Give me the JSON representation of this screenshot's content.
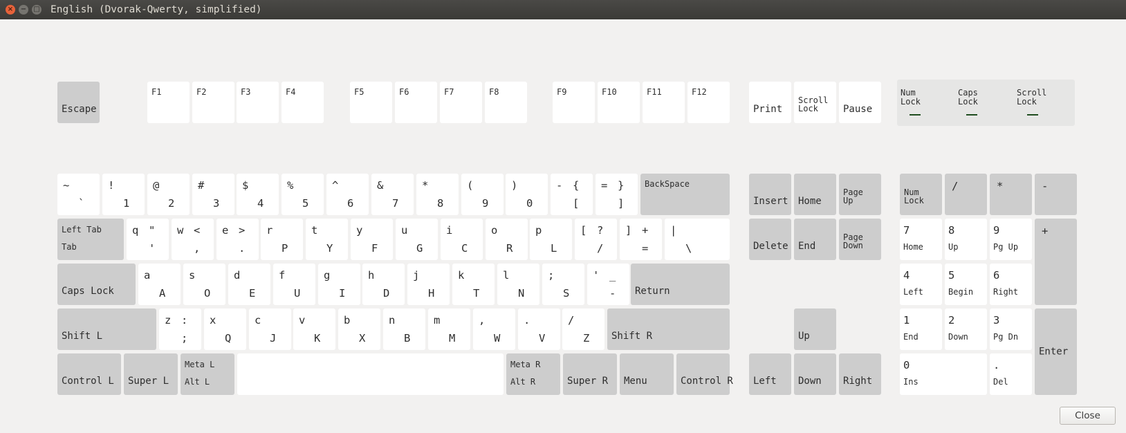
{
  "window": {
    "title": "English (Dvorak-Qwerty, simplified)",
    "close_glyph": "×",
    "minimize_glyph": "−",
    "maximize_glyph": "□"
  },
  "colors": {
    "titlebar": "#3c3b37",
    "background": "#f2f1f0",
    "key_light": "#ffffff",
    "key_dark": "#cdcdcd",
    "indicator_panel": "#e6e6e5",
    "led": "#1f4d1f"
  },
  "keys": [
    {
      "name": "escape",
      "labels": [
        "Escape"
      ]
    },
    {
      "name": "f1",
      "labels": [
        "F1"
      ]
    },
    {
      "name": "f2",
      "labels": [
        "F2"
      ]
    },
    {
      "name": "f3",
      "labels": [
        "F3"
      ]
    },
    {
      "name": "f4",
      "labels": [
        "F4"
      ]
    },
    {
      "name": "f5",
      "labels": [
        "F5"
      ]
    },
    {
      "name": "f6",
      "labels": [
        "F6"
      ]
    },
    {
      "name": "f7",
      "labels": [
        "F7"
      ]
    },
    {
      "name": "f8",
      "labels": [
        "F8"
      ]
    },
    {
      "name": "f9",
      "labels": [
        "F9"
      ]
    },
    {
      "name": "f10",
      "labels": [
        "F10"
      ]
    },
    {
      "name": "f11",
      "labels": [
        "F11"
      ]
    },
    {
      "name": "f12",
      "labels": [
        "F12"
      ]
    },
    {
      "name": "print",
      "labels": [
        "Print"
      ]
    },
    {
      "name": "scroll-lock",
      "labels": [
        "Scroll\nLock"
      ]
    },
    {
      "name": "pause",
      "labels": [
        "Pause"
      ]
    },
    {
      "name": "grave",
      "labels": [
        "~",
        "`"
      ]
    },
    {
      "name": "1",
      "labels": [
        "!",
        "1"
      ]
    },
    {
      "name": "2",
      "labels": [
        "@",
        "2"
      ]
    },
    {
      "name": "3",
      "labels": [
        "#",
        "3"
      ]
    },
    {
      "name": "4",
      "labels": [
        "$",
        "4"
      ]
    },
    {
      "name": "5",
      "labels": [
        "%",
        "5"
      ]
    },
    {
      "name": "6",
      "labels": [
        "^",
        "6"
      ]
    },
    {
      "name": "7",
      "labels": [
        "&",
        "7"
      ]
    },
    {
      "name": "8",
      "labels": [
        "*",
        "8"
      ]
    },
    {
      "name": "9",
      "labels": [
        "(",
        "9"
      ]
    },
    {
      "name": "0",
      "labels": [
        ")",
        "0"
      ]
    },
    {
      "name": "minus",
      "labels": [
        "-",
        "{",
        "["
      ]
    },
    {
      "name": "equal",
      "labels": [
        "=",
        "}",
        "]"
      ]
    },
    {
      "name": "backspace",
      "labels": [
        "BackSpace"
      ]
    },
    {
      "name": "insert",
      "labels": [
        "Insert"
      ]
    },
    {
      "name": "home",
      "labels": [
        "Home"
      ]
    },
    {
      "name": "page-up",
      "labels": [
        "Page\nUp"
      ]
    },
    {
      "name": "num-lock",
      "labels": [
        "Num\nLock"
      ]
    },
    {
      "name": "kp-divide",
      "labels": [
        "/"
      ]
    },
    {
      "name": "kp-multiply",
      "labels": [
        "*"
      ]
    },
    {
      "name": "kp-minus",
      "labels": [
        "-"
      ]
    },
    {
      "name": "tab",
      "labels": [
        "Left Tab",
        "Tab"
      ]
    },
    {
      "name": "q",
      "labels": [
        "q",
        "\"",
        "'"
      ]
    },
    {
      "name": "w",
      "labels": [
        "w",
        "<",
        ","
      ]
    },
    {
      "name": "e",
      "labels": [
        "e",
        ">",
        "."
      ]
    },
    {
      "name": "r",
      "labels": [
        "r",
        "P"
      ]
    },
    {
      "name": "t",
      "labels": [
        "t",
        "Y"
      ]
    },
    {
      "name": "y",
      "labels": [
        "y",
        "F"
      ]
    },
    {
      "name": "u",
      "labels": [
        "u",
        "G"
      ]
    },
    {
      "name": "i",
      "labels": [
        "i",
        "C"
      ]
    },
    {
      "name": "o",
      "labels": [
        "o",
        "R"
      ]
    },
    {
      "name": "p",
      "labels": [
        "p",
        "L"
      ]
    },
    {
      "name": "bracket-left",
      "labels": [
        "[",
        "?",
        "/"
      ]
    },
    {
      "name": "bracket-right",
      "labels": [
        "]",
        "+",
        "="
      ]
    },
    {
      "name": "backslash",
      "labels": [
        "|",
        "\\"
      ]
    },
    {
      "name": "delete",
      "labels": [
        "Delete"
      ]
    },
    {
      "name": "end",
      "labels": [
        "End"
      ]
    },
    {
      "name": "page-down",
      "labels": [
        "Page\nDown"
      ]
    },
    {
      "name": "kp-7",
      "labels": [
        "7",
        "Home"
      ]
    },
    {
      "name": "kp-8",
      "labels": [
        "8",
        "Up"
      ]
    },
    {
      "name": "kp-9",
      "labels": [
        "9",
        "Pg Up"
      ]
    },
    {
      "name": "kp-plus",
      "labels": [
        "+"
      ]
    },
    {
      "name": "caps-lock",
      "labels": [
        "Caps Lock"
      ]
    },
    {
      "name": "a",
      "labels": [
        "a",
        "A"
      ]
    },
    {
      "name": "s",
      "labels": [
        "s",
        "O"
      ]
    },
    {
      "name": "d",
      "labels": [
        "d",
        "E"
      ]
    },
    {
      "name": "f",
      "labels": [
        "f",
        "U"
      ]
    },
    {
      "name": "g",
      "labels": [
        "g",
        "I"
      ]
    },
    {
      "name": "h",
      "labels": [
        "h",
        "D"
      ]
    },
    {
      "name": "j",
      "labels": [
        "j",
        "H"
      ]
    },
    {
      "name": "k",
      "labels": [
        "k",
        "T"
      ]
    },
    {
      "name": "l",
      "labels": [
        "l",
        "N"
      ]
    },
    {
      "name": "semicolon",
      "labels": [
        ";",
        "S"
      ]
    },
    {
      "name": "apostrophe",
      "labels": [
        "'",
        "_",
        "-"
      ]
    },
    {
      "name": "return",
      "labels": [
        "Return"
      ]
    },
    {
      "name": "kp-4",
      "labels": [
        "4",
        "Left"
      ]
    },
    {
      "name": "kp-5",
      "labels": [
        "5",
        "Begin"
      ]
    },
    {
      "name": "kp-6",
      "labels": [
        "6",
        "Right"
      ]
    },
    {
      "name": "shift-left",
      "labels": [
        "Shift L"
      ]
    },
    {
      "name": "z",
      "labels": [
        "z",
        ":",
        ";"
      ]
    },
    {
      "name": "x",
      "labels": [
        "x",
        "Q"
      ]
    },
    {
      "name": "c",
      "labels": [
        "c",
        "J"
      ]
    },
    {
      "name": "v",
      "labels": [
        "v",
        "K"
      ]
    },
    {
      "name": "b",
      "labels": [
        "b",
        "X"
      ]
    },
    {
      "name": "n",
      "labels": [
        "n",
        "B"
      ]
    },
    {
      "name": "m",
      "labels": [
        "m",
        "M"
      ]
    },
    {
      "name": "comma",
      "labels": [
        ",",
        "W"
      ]
    },
    {
      "name": "period",
      "labels": [
        ".",
        "V"
      ]
    },
    {
      "name": "slash",
      "labels": [
        "/",
        "Z"
      ]
    },
    {
      "name": "shift-right",
      "labels": [
        "Shift R"
      ]
    },
    {
      "name": "arrow-up",
      "labels": [
        "Up"
      ]
    },
    {
      "name": "kp-1",
      "labels": [
        "1",
        "End"
      ]
    },
    {
      "name": "kp-2",
      "labels": [
        "2",
        "Down"
      ]
    },
    {
      "name": "kp-3",
      "labels": [
        "3",
        "Pg Dn"
      ]
    },
    {
      "name": "kp-enter",
      "labels": [
        "Enter"
      ]
    },
    {
      "name": "control-left",
      "labels": [
        "Control L"
      ]
    },
    {
      "name": "super-left",
      "labels": [
        "Super L"
      ]
    },
    {
      "name": "alt-left",
      "labels": [
        "Meta L",
        "Alt L"
      ]
    },
    {
      "name": "space",
      "labels": []
    },
    {
      "name": "alt-right",
      "labels": [
        "Meta R",
        "Alt R"
      ]
    },
    {
      "name": "super-right",
      "labels": [
        "Super R"
      ]
    },
    {
      "name": "menu",
      "labels": [
        "Menu"
      ]
    },
    {
      "name": "control-right",
      "labels": [
        "Control R"
      ]
    },
    {
      "name": "arrow-left",
      "labels": [
        "Left"
      ]
    },
    {
      "name": "arrow-down",
      "labels": [
        "Down"
      ]
    },
    {
      "name": "arrow-right",
      "labels": [
        "Right"
      ]
    },
    {
      "name": "kp-0",
      "labels": [
        "0",
        "Ins"
      ]
    },
    {
      "name": "kp-decimal",
      "labels": [
        ".",
        "Del"
      ]
    }
  ],
  "indicators": {
    "num_lock": "Num\nLock",
    "caps_lock": "Caps\nLock",
    "scroll_lock": "Scroll\nLock"
  },
  "close_button": "Close"
}
